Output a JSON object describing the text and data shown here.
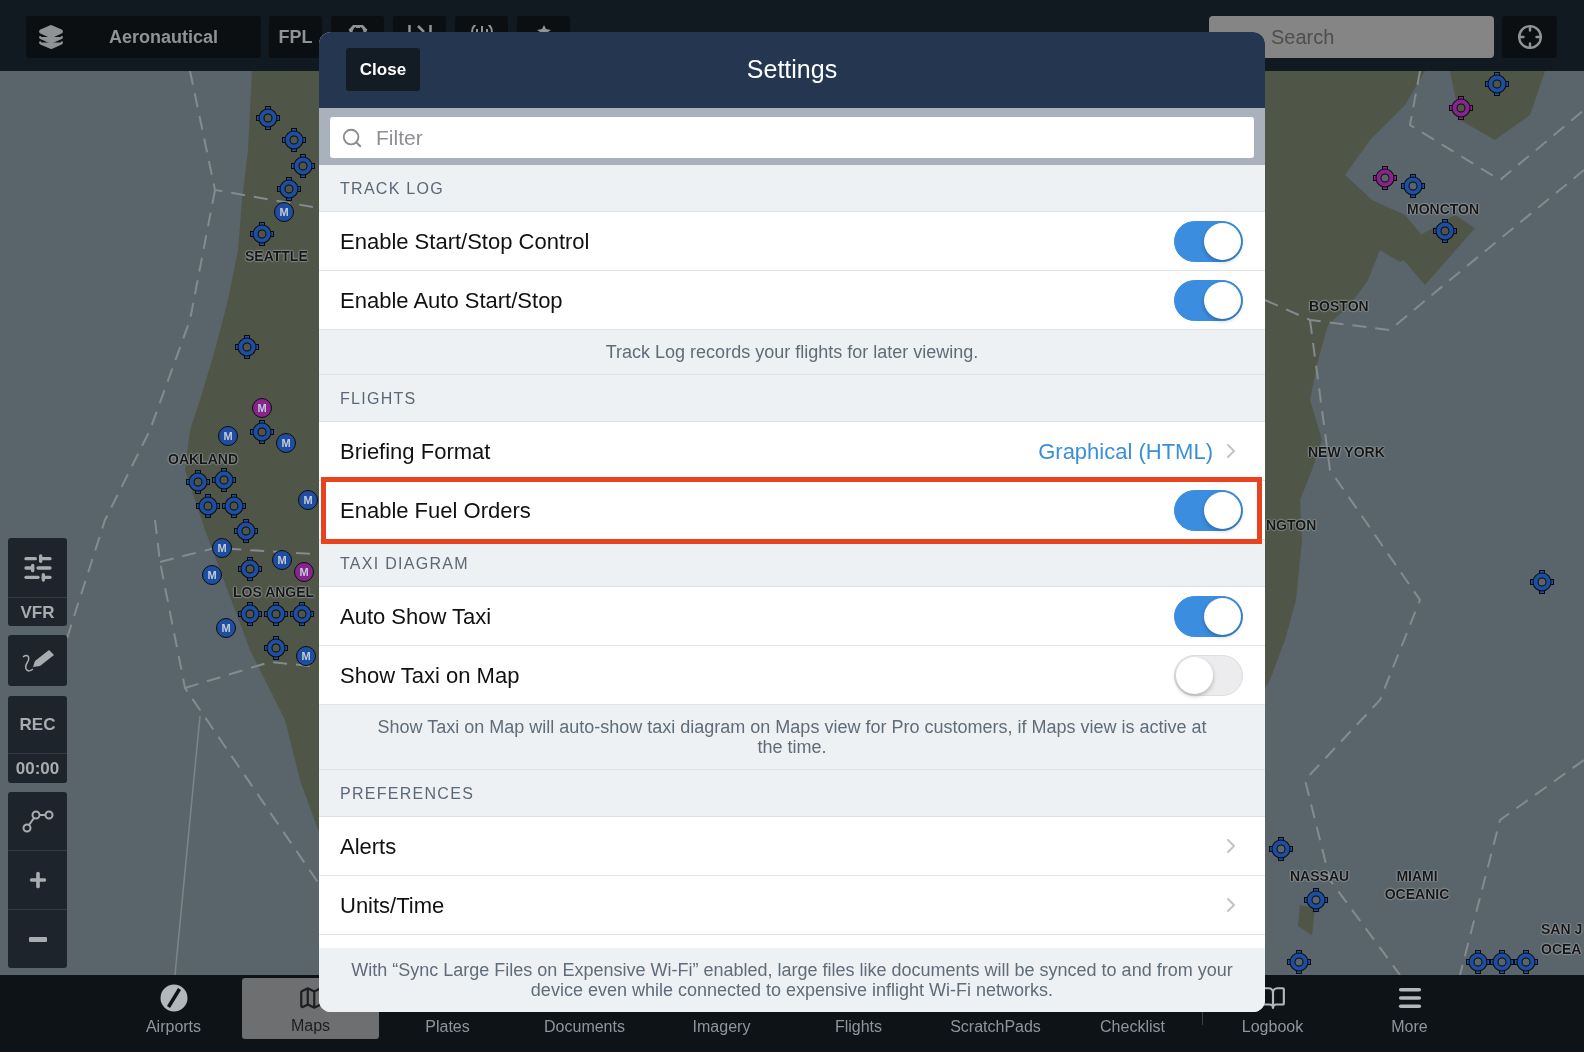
{
  "top_bar": {
    "layer_button": {
      "label": "Aeronautical"
    },
    "buttons": [
      {
        "kind": "text",
        "label": "FPL"
      },
      {
        "kind": "gear"
      },
      {
        "kind": "measure"
      },
      {
        "kind": "globe"
      },
      {
        "kind": "star"
      }
    ],
    "search": {
      "placeholder": "Search"
    }
  },
  "map": {
    "labels": [
      {
        "text": "SEATTLE"
      },
      {
        "text": "OAKLAND"
      },
      {
        "text": "LOS ANGEL"
      },
      {
        "text": "MONCTON"
      },
      {
        "text": "BOSTON"
      },
      {
        "text": "NEW YORK"
      },
      {
        "text": "NGTON"
      },
      {
        "text": "NASSAU"
      },
      {
        "text": "MIAMI OCEANIC"
      },
      {
        "text": "SAN J"
      },
      {
        "text": "OCEA"
      }
    ],
    "markers": [
      {
        "kind": "ring",
        "color": "#1f4d9f"
      },
      {
        "kind": "ring",
        "color": "#1f4d9f"
      },
      {
        "kind": "ring",
        "color": "#1f4d9f"
      },
      {
        "kind": "ring",
        "color": "#1f4d9f"
      },
      {
        "kind": "letter",
        "label": "M",
        "color": "#1f4d9f"
      },
      {
        "kind": "ring",
        "color": "#1f4d9f"
      },
      {
        "kind": "ring",
        "color": "#1f4d9f"
      },
      {
        "kind": "letter",
        "label": "M",
        "color": "#86268c"
      },
      {
        "kind": "ring",
        "color": "#1f4d9f"
      },
      {
        "kind": "letter",
        "label": "M",
        "color": "#1f4d9f"
      },
      {
        "kind": "letter",
        "label": "M",
        "color": "#1f4d9f"
      },
      {
        "kind": "ring",
        "color": "#1f4d9f"
      },
      {
        "kind": "ring",
        "color": "#1f4d9f"
      },
      {
        "kind": "ring",
        "color": "#1f4d9f"
      },
      {
        "kind": "ring",
        "color": "#1f4d9f"
      },
      {
        "kind": "ring",
        "color": "#1f4d9f"
      },
      {
        "kind": "letter",
        "label": "M",
        "color": "#1f4d9f"
      },
      {
        "kind": "letter",
        "label": "M",
        "color": "#1f4d9f"
      },
      {
        "kind": "ring",
        "color": "#1f4d9f"
      },
      {
        "kind": "letter",
        "label": "M",
        "color": "#1f4d9f"
      },
      {
        "kind": "letter",
        "label": "M",
        "color": "#1f4d9f"
      },
      {
        "kind": "letter",
        "label": "M",
        "color": "#86268c"
      },
      {
        "kind": "ring",
        "color": "#1f4d9f"
      },
      {
        "kind": "ring",
        "color": "#1f4d9f"
      },
      {
        "kind": "ring",
        "color": "#1f4d9f"
      },
      {
        "kind": "letter",
        "label": "M",
        "color": "#1f4d9f"
      },
      {
        "kind": "ring",
        "color": "#1f4d9f"
      },
      {
        "kind": "letter",
        "label": "M",
        "color": "#1f4d9f"
      },
      {
        "kind": "ring",
        "color": "#1f4d9f"
      },
      {
        "kind": "ring",
        "color": "#86268c"
      },
      {
        "kind": "ring",
        "color": "#86268c"
      },
      {
        "kind": "ring",
        "color": "#1f4d9f"
      },
      {
        "kind": "ring",
        "color": "#1f4d9f"
      },
      {
        "kind": "ring",
        "color": "#1f4d9f"
      },
      {
        "kind": "ring",
        "color": "#1f4d9f"
      },
      {
        "kind": "ring",
        "color": "#1f4d9f"
      },
      {
        "kind": "ring",
        "color": "#1f4d9f"
      },
      {
        "kind": "ring",
        "color": "#1f4d9f"
      },
      {
        "kind": "ring",
        "color": "#1f4d9f"
      },
      {
        "kind": "ring",
        "color": "#1f4d9f"
      }
    ]
  },
  "map_controls": [
    {
      "kind": "settings",
      "label": "VFR"
    },
    {
      "kind": "draw"
    },
    {
      "kind": "record",
      "label": "REC",
      "reading": "00:00"
    },
    {
      "kind": "route"
    },
    {
      "kind": "zoom_in"
    },
    {
      "kind": "zoom_out"
    }
  ],
  "settings": {
    "close_button": "Close",
    "title": "Settings",
    "filter": {
      "placeholder": "Filter"
    },
    "sections": [
      {
        "header": "TRACK LOG",
        "rows": [
          {
            "kind": "toggle",
            "label": "Enable Start/Stop Control",
            "on": true,
            "highlighted": false
          },
          {
            "kind": "toggle",
            "label": "Enable Auto Start/Stop",
            "on": true,
            "highlighted": false
          }
        ],
        "footer": "Track Log records your flights for later viewing."
      },
      {
        "header": "FLIGHTS",
        "rows": [
          {
            "kind": "link",
            "label": "Briefing Format",
            "value": "Graphical (HTML)",
            "highlighted": false
          },
          {
            "kind": "toggle",
            "label": "Enable Fuel Orders",
            "on": true,
            "highlighted": true
          }
        ]
      },
      {
        "header": "TAXI DIAGRAM",
        "rows": [
          {
            "kind": "toggle",
            "label": "Auto Show Taxi",
            "on": true,
            "highlighted": false
          },
          {
            "kind": "toggle",
            "label": "Show Taxi on Map",
            "on": false,
            "highlighted": false
          }
        ],
        "footer": "Show Taxi on Map will auto-show taxi diagram on Maps view for Pro customers, if Maps view is active at the time."
      },
      {
        "header": "PREFERENCES",
        "rows": [
          {
            "kind": "link",
            "label": "Alerts",
            "highlighted": false
          },
          {
            "kind": "link",
            "label": "Units/Time",
            "highlighted": false
          }
        ]
      }
    ],
    "bottom_note": "With “Sync Large Files on Expensive Wi-Fi” enabled, large files like documents will be synced to and from your device even while connected to expensive inflight Wi-Fi networks."
  },
  "tab_bar": [
    {
      "kind": "airports",
      "label": "Airports",
      "selected": false
    },
    {
      "kind": "maps",
      "label": "Maps",
      "selected": true
    },
    {
      "kind": "plates",
      "label": "Plates",
      "selected": false
    },
    {
      "kind": "documents",
      "label": "Documents",
      "selected": false
    },
    {
      "kind": "imagery",
      "label": "Imagery",
      "selected": false
    },
    {
      "kind": "flights",
      "label": "Flights",
      "selected": false
    },
    {
      "kind": "scratchpads",
      "label": "ScratchPads",
      "selected": false
    },
    {
      "kind": "checklist",
      "label": "Checklist",
      "selected": false
    },
    {
      "kind": "logbook",
      "label": "Logbook",
      "selected": false
    },
    {
      "kind": "more",
      "label": "More",
      "selected": false
    }
  ]
}
